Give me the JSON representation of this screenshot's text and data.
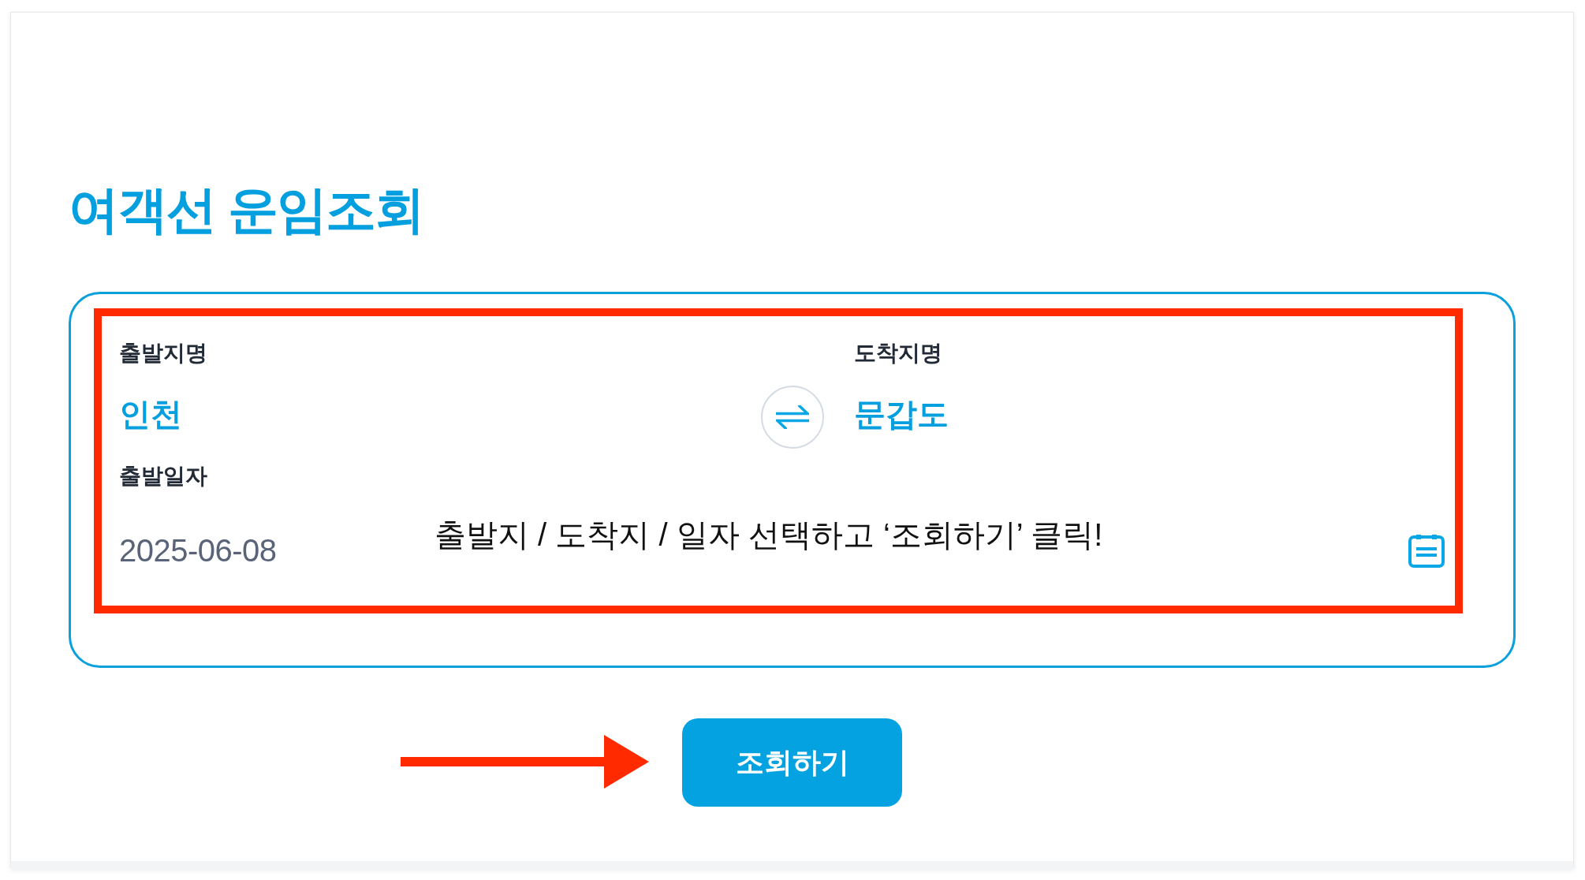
{
  "page_title": "여객선 운임조회",
  "search_form": {
    "departure": {
      "label": "출발지명",
      "value": "인천"
    },
    "arrival": {
      "label": "도착지명",
      "value": "문갑도"
    },
    "date": {
      "label": "출발일자",
      "value": "2025-06-08"
    }
  },
  "annotation": {
    "text": "출발지 / 도착지 / 일자 선택하고 ‘조회하기’ 클릭!"
  },
  "search_button": {
    "label": "조회하기"
  }
}
